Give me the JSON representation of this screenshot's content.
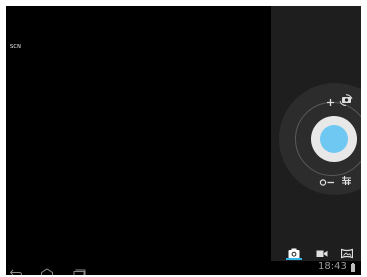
{
  "viewfinder": {
    "scene_mode_label": "SCN"
  },
  "camera_controls": {
    "zoom_in_icon": "plus-icon",
    "zoom_out_icon": "minus-icon",
    "switch_camera_icon": "switch-camera-icon",
    "settings_icon": "sliders-icon",
    "shutter_icon": "shutter-button",
    "shutter_color": "#6fc8f1"
  },
  "mode_switcher": {
    "modes": [
      "photo",
      "video",
      "panorama"
    ],
    "selected": "photo",
    "accent_color": "#33b5e5"
  },
  "system_bar": {
    "time": "18:43",
    "nav_icons": [
      "back-icon",
      "home-icon",
      "recents-icon"
    ],
    "battery_icon": "battery-icon"
  }
}
